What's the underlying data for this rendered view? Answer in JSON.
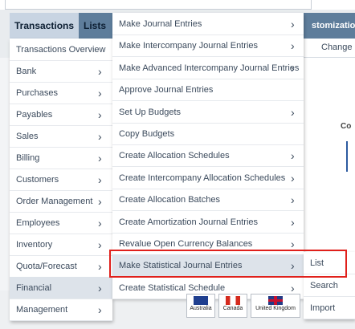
{
  "navbar": {
    "tabs": [
      "Transactions",
      "Lists"
    ],
    "right_tab": "stomization"
  },
  "subbar": {
    "label": "Change"
  },
  "background": {
    "heading_fragment": "Co"
  },
  "menu_level1": {
    "items": [
      {
        "label": "Transactions Overview",
        "arrow": false
      },
      {
        "label": "Bank",
        "arrow": true
      },
      {
        "label": "Purchases",
        "arrow": true
      },
      {
        "label": "Payables",
        "arrow": true
      },
      {
        "label": "Sales",
        "arrow": true
      },
      {
        "label": "Billing",
        "arrow": true
      },
      {
        "label": "Customers",
        "arrow": true
      },
      {
        "label": "Order Management",
        "arrow": true
      },
      {
        "label": "Employees",
        "arrow": true
      },
      {
        "label": "Inventory",
        "arrow": true
      },
      {
        "label": "Quota/Forecast",
        "arrow": true
      },
      {
        "label": "Financial",
        "arrow": true,
        "selected": true
      },
      {
        "label": "Management",
        "arrow": true
      }
    ]
  },
  "menu_level2": {
    "items": [
      {
        "label": "Make Journal Entries",
        "arrow": true
      },
      {
        "label": "Make Intercompany Journal Entries",
        "arrow": true
      },
      {
        "label": "Make Advanced Intercompany Journal Entries",
        "arrow": true
      },
      {
        "label": "Approve Journal Entries",
        "arrow": false
      },
      {
        "label": "Set Up Budgets",
        "arrow": true
      },
      {
        "label": "Copy Budgets",
        "arrow": false
      },
      {
        "label": "Create Allocation Schedules",
        "arrow": true
      },
      {
        "label": "Create Intercompany Allocation Schedules",
        "arrow": true
      },
      {
        "label": "Create Allocation Batches",
        "arrow": true
      },
      {
        "label": "Create Amortization Journal Entries",
        "arrow": true
      },
      {
        "label": "Revalue Open Currency Balances",
        "arrow": true
      },
      {
        "label": "Make Statistical Journal Entries",
        "arrow": true,
        "selected": true
      },
      {
        "label": "Create Statistical Schedule",
        "arrow": true
      }
    ]
  },
  "menu_level3": {
    "items": [
      "List",
      "Search",
      "Import"
    ]
  },
  "flags": [
    "Australia",
    "Canada",
    "United Kingdom"
  ],
  "arrow_glyph": "›",
  "colors": {
    "navbar": "#5e7d9b",
    "highlight": "#e0201b",
    "hover": "#dde3ea"
  }
}
